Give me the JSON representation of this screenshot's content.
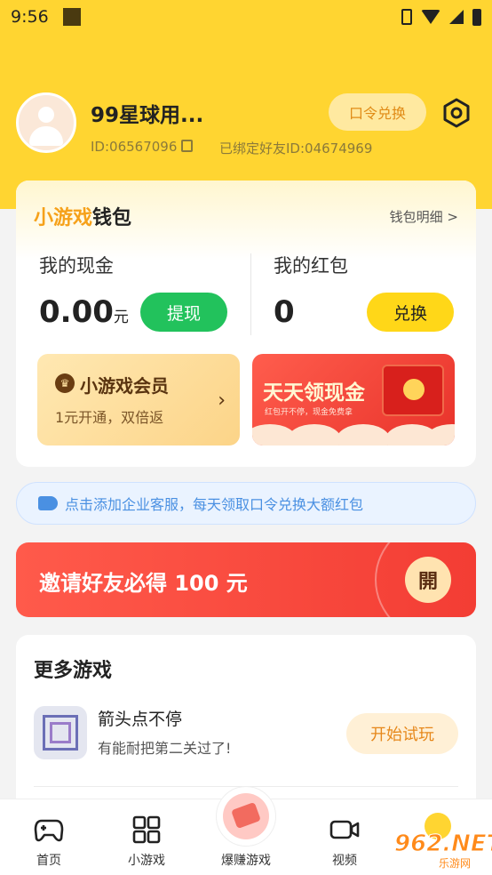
{
  "status_bar": {
    "time": "9:56"
  },
  "profile": {
    "nickname": "99星球用...",
    "user_id": "ID:06567096",
    "bound_friend": "已绑定好友ID:04674969",
    "command_exchange_label": "口令兑换"
  },
  "wallet": {
    "title_highlight": "小游戏",
    "title_rest": "钱包",
    "detail_link": "钱包明细 >",
    "cash_label": "我的现金",
    "cash_value": "0.00",
    "cash_unit": "元",
    "withdraw_label": "提现",
    "redpacket_label": "我的红包",
    "redpacket_value": "0",
    "exchange_label": "兑换",
    "vip": {
      "icon_glyph": "♛",
      "title": "小游戏会员",
      "subtitle": "1元开通，双倍返",
      "arrow": "›"
    },
    "cash_banner": {
      "title": "天天领现金",
      "subtitle": "红包开不停，现金免费拿"
    }
  },
  "notice": {
    "text": "点击添加企业客服，每天领取口令兑换大额红包"
  },
  "invite": {
    "text": "邀请好友必得 100 元",
    "open_label": "開"
  },
  "more_games": {
    "title": "更多游戏",
    "games": [
      {
        "name": "箭头点不停",
        "desc": "有能耐把第二关过了!",
        "button": "开始试玩"
      }
    ]
  },
  "bottom_nav": {
    "items": [
      {
        "label": "首页",
        "icon": "gamepad-icon"
      },
      {
        "label": "小游戏",
        "icon": "grid-icon"
      },
      {
        "label": "爆赚游戏",
        "icon": "cash-icon"
      },
      {
        "label": "视频",
        "icon": "video-icon"
      }
    ]
  },
  "watermark": {
    "text": "962.NET",
    "sub": "乐游网"
  },
  "colors": {
    "header_yellow": "#ffd531",
    "withdraw_green": "#22c25c",
    "exchange_yellow": "#ffd718",
    "invite_red": "#f33d34",
    "notice_blue": "#4a90e2",
    "accent_orange": "#e6871a"
  }
}
